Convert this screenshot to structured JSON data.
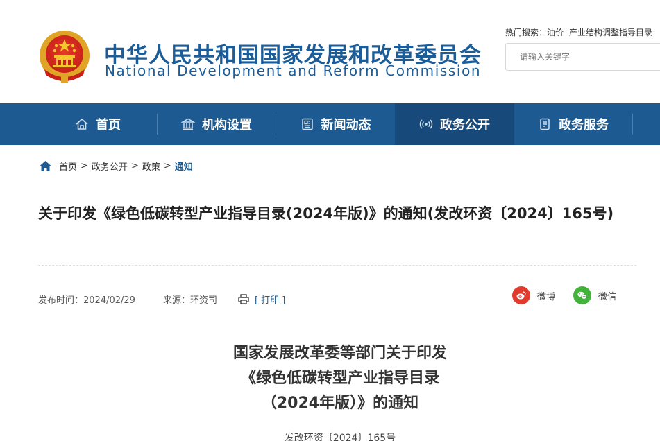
{
  "header": {
    "site_name_cn": "中华人民共和国国家发展和改革委员会",
    "site_name_en": "National Development and Reform Commission",
    "hot_search_label": "热门搜索：",
    "hot_keywords": [
      "油价",
      "产业结构调整指导目录"
    ],
    "search_placeholder": "请输入关键字"
  },
  "nav": {
    "items": [
      {
        "label": "首页",
        "icon": "home-icon"
      },
      {
        "label": "机构设置",
        "icon": "institution-icon"
      },
      {
        "label": "新闻动态",
        "icon": "news-icon"
      },
      {
        "label": "政务公开",
        "icon": "broadcast-icon",
        "active": true
      },
      {
        "label": "政务服务",
        "icon": "document-icon"
      }
    ]
  },
  "breadcrumb": {
    "items": [
      "首页",
      "政务公开",
      "政策",
      "通知"
    ],
    "separator": ">"
  },
  "article": {
    "title": "关于印发《绿色低碳转型产业指导目录(2024年版)》的通知(发改环资〔2024〕165号)",
    "publish_label": "发布时间：2024/02/29",
    "source_label": "来源：环资司",
    "print_label": "[ 打印 ]",
    "share_weibo": "微博",
    "share_wechat": "微信",
    "doc_heading_lines": [
      "国家发展改革委等部门关于印发",
      "《绿色低碳转型产业指导目录",
      "（2024年版）》的通知"
    ],
    "doc_number": "发改环资〔2024〕165号"
  },
  "colors": {
    "brand_blue": "#1d5a91",
    "nav_active": "#174a7a",
    "weibo_red": "#e03b2c",
    "wechat_green": "#43b23a"
  }
}
